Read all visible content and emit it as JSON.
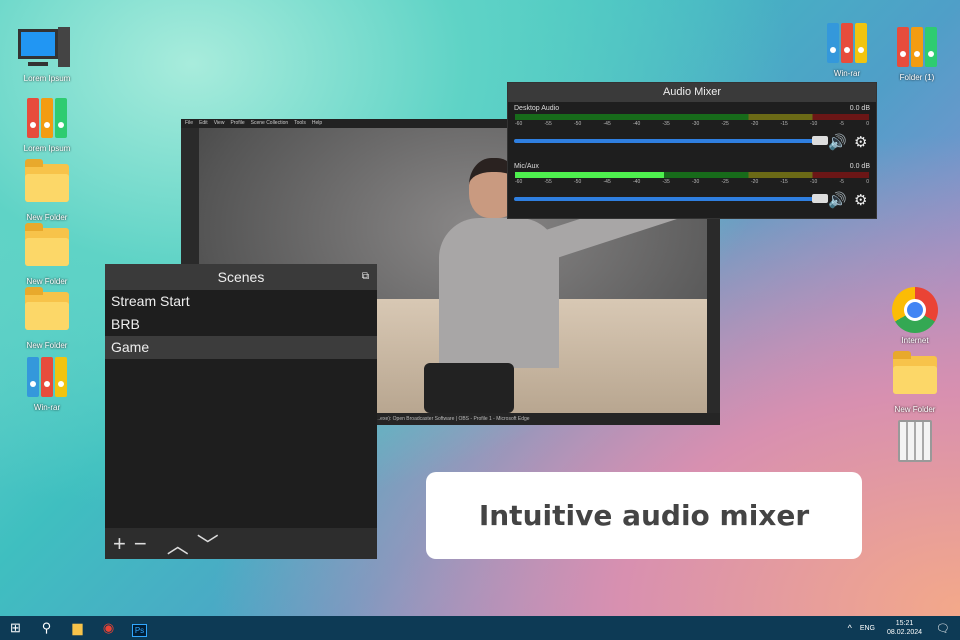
{
  "desktop_left": [
    {
      "label": "Lorem Ipsum",
      "icon": "computer-icon"
    },
    {
      "label": "Lorem Ipsum",
      "icon": "binders-icon"
    },
    {
      "label": "New Folder",
      "icon": "folder-icon"
    },
    {
      "label": "New Folder",
      "icon": "folder-icon"
    },
    {
      "label": "New Folder",
      "icon": "folder-icon"
    },
    {
      "label": "Win-rar",
      "icon": "winrar-icon"
    }
  ],
  "desktop_right": [
    {
      "label": "Win-rar"
    },
    {
      "label": "Folder (1)"
    },
    {
      "label": "Internet"
    },
    {
      "label": "New Folder"
    }
  ],
  "obs": {
    "menu": [
      "File",
      "Edit",
      "View",
      "Profile",
      "Scene Collection",
      "Tools",
      "Help"
    ],
    "status": "...exe): Open Broadcaster Software | OBS - Profile 1 - Microsoft Edge"
  },
  "mixer": {
    "title": "Audio Mixer",
    "channels": [
      {
        "name": "Desktop Audio",
        "db": "0.0 dB",
        "level_fraction": 0.0,
        "volume_fraction": 1.0
      },
      {
        "name": "Mic/Aux",
        "db": "0.0 dB",
        "level_fraction": 0.42,
        "volume_fraction": 1.0
      }
    ],
    "ticks": [
      "-60",
      "-55",
      "-50",
      "-45",
      "-40",
      "-35",
      "-30",
      "-25",
      "-20",
      "-15",
      "-10",
      "-5",
      "0"
    ]
  },
  "scenes": {
    "title": "Scenes",
    "items": [
      "Stream Start",
      "BRB",
      "Game"
    ],
    "selected": "Game"
  },
  "callout": "Intuitive audio mixer",
  "taskbar": {
    "lang": "ENG",
    "time": "15:21",
    "date": "08.02.2024"
  }
}
